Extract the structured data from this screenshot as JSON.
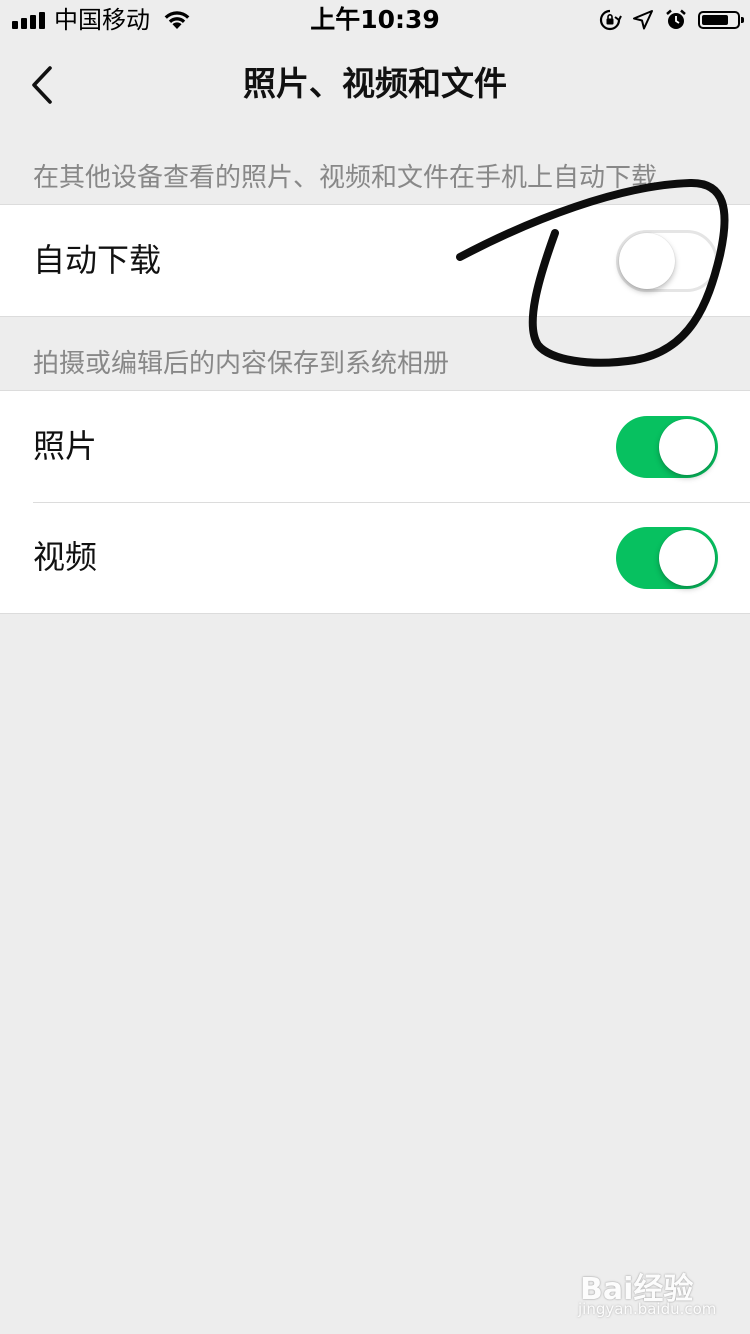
{
  "status_bar": {
    "carrier": "中国移动",
    "time": "上午10:39",
    "battery_level": 0.75
  },
  "nav": {
    "title": "照片、视频和文件"
  },
  "sections": [
    {
      "header": "在其他设备查看的照片、视频和文件在手机上自动下载",
      "rows": [
        {
          "label": "自动下载",
          "switch_on": false
        }
      ]
    },
    {
      "header": "拍摄或编辑后的内容保存到系统相册",
      "rows": [
        {
          "label": "照片",
          "switch_on": true
        },
        {
          "label": "视频",
          "switch_on": true
        }
      ]
    }
  ],
  "colors": {
    "switch_on": "#07c160",
    "background": "#ededed"
  },
  "watermark": {
    "text": "Bai经验",
    "sub": "jingyan.baidu.com"
  },
  "icons": [
    "signal-icon",
    "wifi-icon",
    "orientation-lock-icon",
    "location-icon",
    "alarm-icon",
    "battery-icon",
    "back-chevron-icon"
  ]
}
